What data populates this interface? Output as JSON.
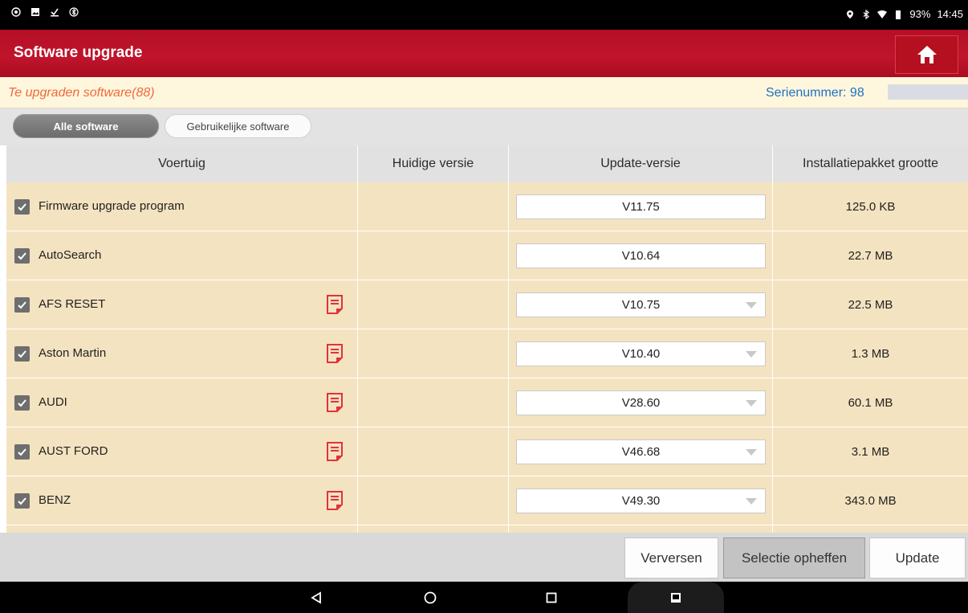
{
  "status_bar": {
    "battery": "93%",
    "time": "14:45"
  },
  "header": {
    "title": "Software upgrade"
  },
  "info": {
    "upgrade_count": "Te upgraden software(88)",
    "serial_label": "Serienummer: 98"
  },
  "tabs": [
    {
      "label": "Alle software",
      "active": true
    },
    {
      "label": "Gebruikelijke software",
      "active": false
    }
  ],
  "table": {
    "columns": [
      "Voertuig",
      "Huidige versie",
      "Update-versie",
      "Installatiepakket grootte"
    ],
    "rows": [
      {
        "name": "Firmware upgrade program",
        "current": "",
        "update": "V11.75",
        "size": "125.0 KB",
        "has_note": false,
        "dropdown": false,
        "checked": true
      },
      {
        "name": "AutoSearch",
        "current": "",
        "update": "V10.64",
        "size": "22.7 MB",
        "has_note": false,
        "dropdown": false,
        "checked": true
      },
      {
        "name": "AFS RESET",
        "current": "",
        "update": "V10.75",
        "size": "22.5 MB",
        "has_note": true,
        "dropdown": true,
        "checked": true
      },
      {
        "name": "Aston Martin",
        "current": "",
        "update": "V10.40",
        "size": "1.3 MB",
        "has_note": true,
        "dropdown": true,
        "checked": true
      },
      {
        "name": "AUDI",
        "current": "",
        "update": "V28.60",
        "size": "60.1 MB",
        "has_note": true,
        "dropdown": true,
        "checked": true
      },
      {
        "name": "AUST FORD",
        "current": "",
        "update": "V46.68",
        "size": "3.1 MB",
        "has_note": true,
        "dropdown": true,
        "checked": true
      },
      {
        "name": "BENZ",
        "current": "",
        "update": "V49.30",
        "size": "343.0 MB",
        "has_note": true,
        "dropdown": true,
        "checked": true
      }
    ]
  },
  "buttons": {
    "refresh": "Verversen",
    "deselect": "Selectie opheffen",
    "update": "Update"
  },
  "colors": {
    "header_red": "#c0142c",
    "row_bg": "#f4e3c0",
    "count_text": "#ee6a3e",
    "serial_text": "#1f70c1"
  }
}
